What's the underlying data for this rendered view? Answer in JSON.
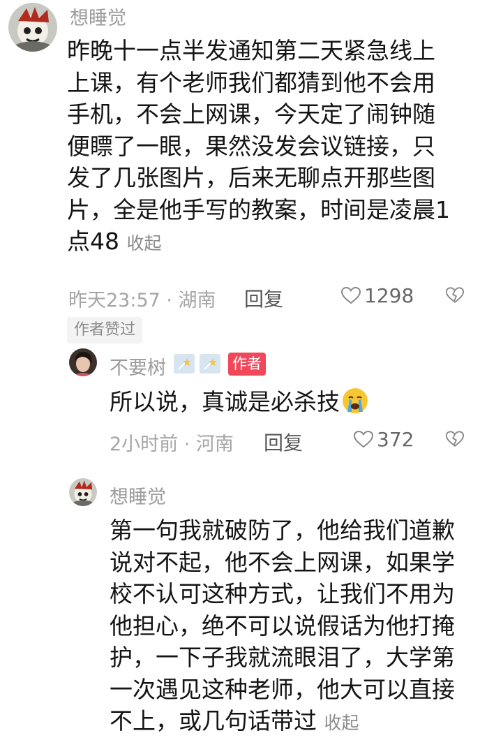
{
  "comments": [
    {
      "username": "想睡觉",
      "lines": [
        "昨晚十一点半发通知第二天紧急线上",
        "上课，有个老师我们都猜到他不会用",
        "手机，不会上网课，今天定了闹钟随",
        "便瞟了一眼，果然没发会议链接，只",
        "发了几张图片，后来无聊点开那些图",
        "片，全是他手写的教案，时间是凌晨1",
        "点48"
      ],
      "collapse_label": "收起",
      "time_location": "昨天23:57 · 湖南",
      "reply_label": "回复",
      "likes": "1298",
      "author_liked": "作者赞过"
    },
    {
      "username": "不要树",
      "author_tag": "作者",
      "text": "所以说，真诚是必杀技",
      "emoji": "crying-face-icon",
      "time_location": "2小时前 · 河南",
      "reply_label": "回复",
      "likes": "372"
    },
    {
      "username": "想睡觉",
      "lines": [
        "第一句我就破防了，他给我们道歉",
        "说对不起，他不会上网课，如果学",
        "校不认可这种方式，让我们不用为",
        "他担心，绝不可以说假话为他打掩",
        "护，一下子我就流眼泪了，大学第",
        "一次遇见这种老师，他大可以直接",
        "不上，或几句话带过"
      ],
      "collapse_label": "收起"
    }
  ],
  "colors": {
    "author_tag": "#f0475b",
    "meta_text": "#a5a5a5",
    "body_text": "#141414"
  }
}
